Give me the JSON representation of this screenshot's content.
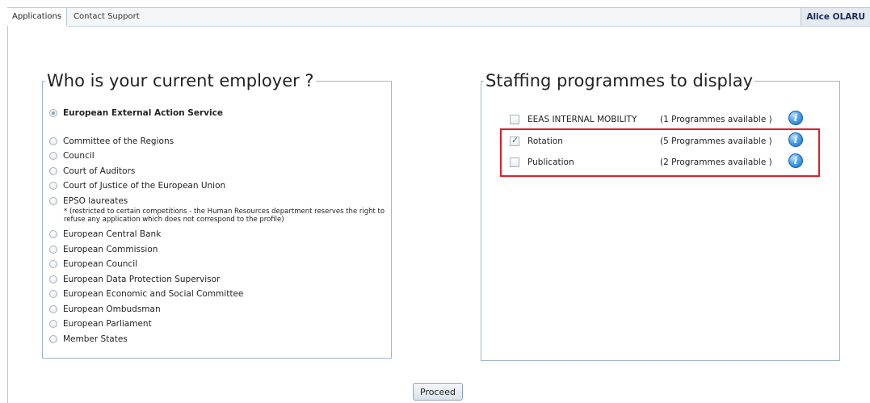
{
  "header": {
    "tabs": [
      {
        "label": "Applications"
      },
      {
        "label": "Contact Support"
      }
    ],
    "user_name": "Alice OLARU"
  },
  "employer": {
    "title": "Who is your current employer ?",
    "selected": "European External Action Service",
    "options": [
      "Committee of the Regions",
      "Council",
      "Court of Auditors",
      "Court of Justice of the European Union",
      "EPSO laureates",
      "European Central Bank",
      "European Commission",
      "European Council",
      "European Data Protection Supervisor",
      "European Economic and Social Committee",
      "European Ombudsman",
      "European Parliament",
      "Member States"
    ],
    "epso_note": "* (restricted to certain competitions - the Human Resources department reserves the right to refuse any application which does not correspond to the profile)"
  },
  "programmes": {
    "title": "Staffing programmes to display",
    "items": [
      {
        "label": "EEAS INTERNAL MOBILITY",
        "available": "(1 Programmes available )",
        "checked": false
      },
      {
        "label": "Rotation",
        "available": "(5 Programmes available )",
        "checked": true
      },
      {
        "label": "Publication",
        "available": "(2 Programmes available )",
        "checked": false
      }
    ]
  },
  "actions": {
    "proceed_label": "Proceed"
  },
  "colors": {
    "highlight": "#e0202a",
    "box_border": "#9fb6cf",
    "info_icon": "#1d6fc4"
  }
}
